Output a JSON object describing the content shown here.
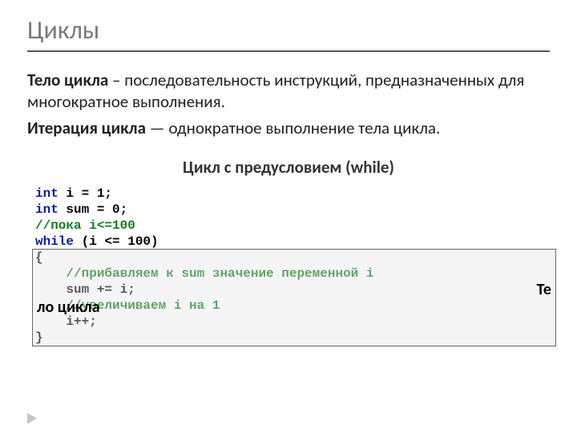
{
  "title": "Циклы",
  "definitions": {
    "body_term": "Тело цикла",
    "body_text": " – последовательность инструкций, предназначенных для многократное выполнения.",
    "iter_term": "Итерация цикла",
    "iter_text": " — однократное выполнение тела цикла."
  },
  "section_heading": "Цикл с предусловием (while)",
  "overlay": {
    "te": "Те",
    "lo": "ло цикла"
  },
  "code": {
    "l1a": "int",
    "l1b": " i = 1;",
    "l2a": "int",
    "l2b": " sum = 0;",
    "l3": "//пока i<=100",
    "l4a": "while",
    "l4b": " (i <= 100)",
    "l5": "{",
    "l6": "    //прибавляем к sum значение переменной i",
    "l7": "    sum += i;",
    "l8": "    //увеличиваем i на 1",
    "l9": "    i++;",
    "l10": "}"
  }
}
